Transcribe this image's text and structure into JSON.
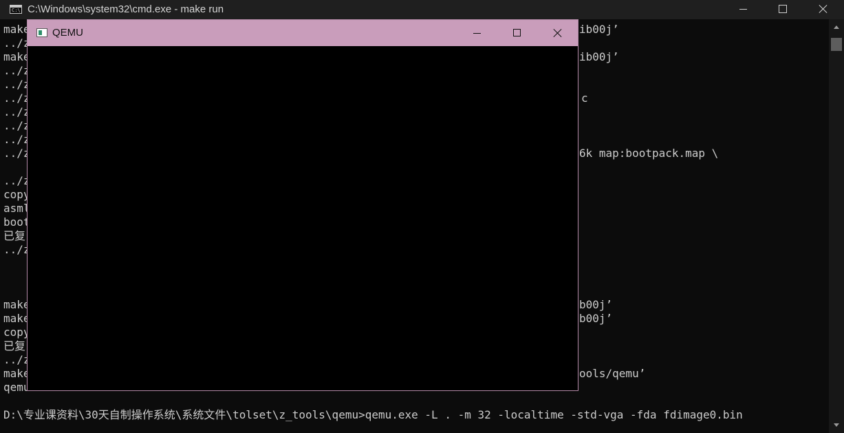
{
  "cmd_window": {
    "title": "C:\\Windows\\system32\\cmd.exe - make  run",
    "icon_text": "C:\\"
  },
  "console": {
    "left_lines": [
      "make",
      "../z",
      "make",
      "../z",
      "../z",
      "../z",
      "../z",
      "../z",
      "../z",
      "../z",
      "",
      "../z",
      "copy",
      "asml",
      "boot",
      "已复",
      "../z",
      "",
      "",
      "",
      "make",
      "make",
      "copy",
      "已复",
      "../z",
      "make",
      "qemu"
    ],
    "right_fragments": [
      "ib00j’",
      "ib00j’",
      "c",
      "6k map:bootpack.map \\",
      "b00j’",
      "b00j’",
      "ools/qemu’"
    ],
    "last_line": "D:\\专业课资料\\30天自制操作系统\\系统文件\\tolset\\z_tools\\qemu>qemu.exe -L . -m 32 -localtime -std-vga -fda fdimage0.bin"
  },
  "qemu_window": {
    "title": "QEMU",
    "display_color": "#000000"
  },
  "colors": {
    "console_bg": "#0c0c0c",
    "console_text": "#cccccc",
    "qemu_titlebar": "#c99dbb"
  }
}
